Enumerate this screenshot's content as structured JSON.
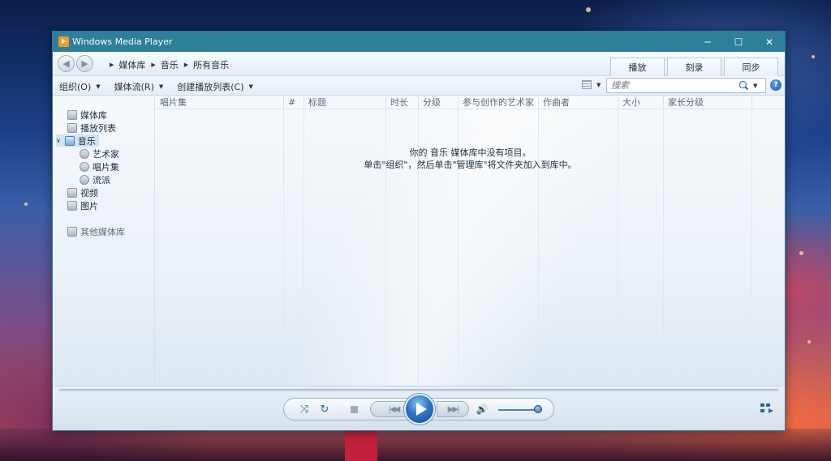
{
  "window": {
    "title": "Windows Media Player",
    "controls": {
      "minimize": "─",
      "maximize": "☐",
      "close": "✕"
    }
  },
  "nav": {
    "back_glyph": "◀",
    "forward_glyph": "▶",
    "breadcrumb": [
      "媒体库",
      "音乐",
      "所有音乐"
    ]
  },
  "tabs": [
    "播放",
    "刻录",
    "同步"
  ],
  "toolbar": {
    "organize": "组织(O)",
    "stream": "媒体流(R)",
    "create_playlist": "创建播放列表(C)"
  },
  "search": {
    "placeholder": "搜索",
    "value": ""
  },
  "help_glyph": "?",
  "sidebar": {
    "library": "媒体库",
    "playlists": "播放列表",
    "music": "音乐",
    "artist": "艺术家",
    "album": "唱片集",
    "genre": "流派",
    "videos": "视频",
    "pictures": "图片",
    "other_libraries": "其他媒体库"
  },
  "columns": [
    "唱片集",
    "#",
    "标题",
    "时长",
    "分级",
    "参与创作的艺术家",
    "作曲者",
    "大小",
    "家长分级"
  ],
  "empty_message": {
    "line1": "你的 音乐 媒体库中没有项目。",
    "line2": "单击\"组织\"，然后单击\"管理库\"将文件夹加入到库中。"
  },
  "player": {
    "shuffle_glyph": "⤨",
    "repeat_glyph": "↻",
    "prev_glyph": "|◀◀",
    "next_glyph": "▶▶|",
    "volume_glyph": "🔊",
    "volume_level": 0.95
  },
  "colors": {
    "titlebar": "#2d7f9b",
    "accent": "#2f63a2",
    "selection": "#cde3f7"
  }
}
